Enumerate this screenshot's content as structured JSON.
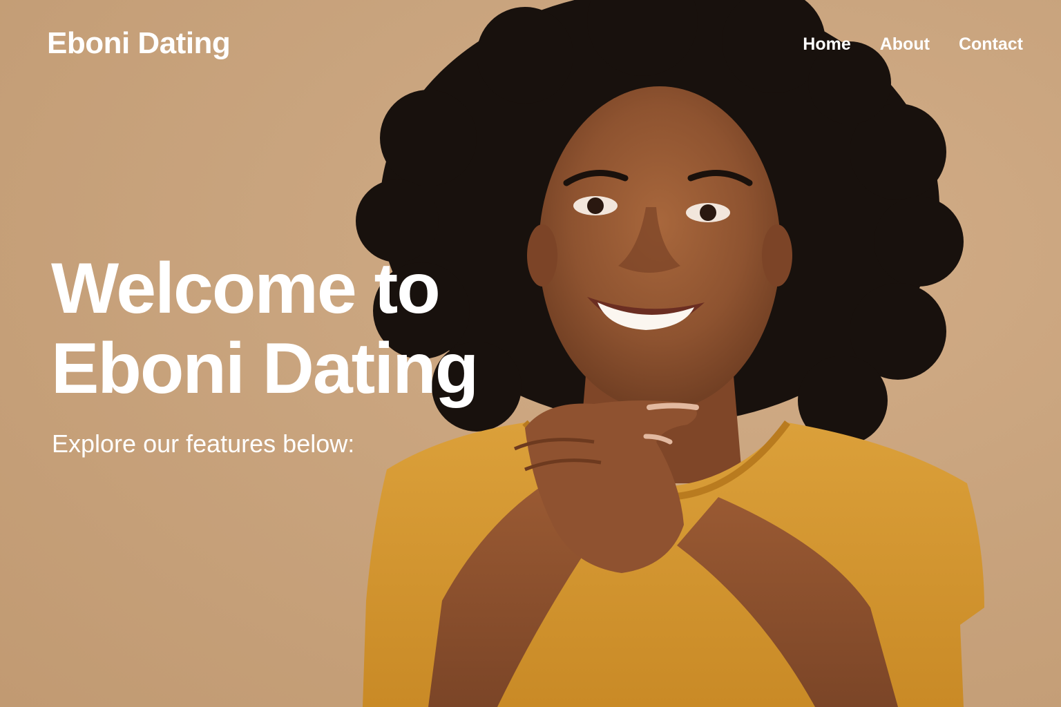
{
  "site": {
    "logo_text": "Eboni Dating"
  },
  "nav": {
    "items": [
      {
        "label": "Home"
      },
      {
        "label": "About"
      },
      {
        "label": "Contact"
      }
    ]
  },
  "hero": {
    "headline_line1": "Welcome to",
    "headline_line2": "Eboni Dating",
    "subheadline": "Explore our features below:",
    "image_subject": "smiling-woman-portrait"
  },
  "colors": {
    "background": "#c9a37c",
    "text": "#ffffff",
    "shirt": "#d4962e",
    "skin": "#8a5230",
    "hair": "#1a1210"
  }
}
